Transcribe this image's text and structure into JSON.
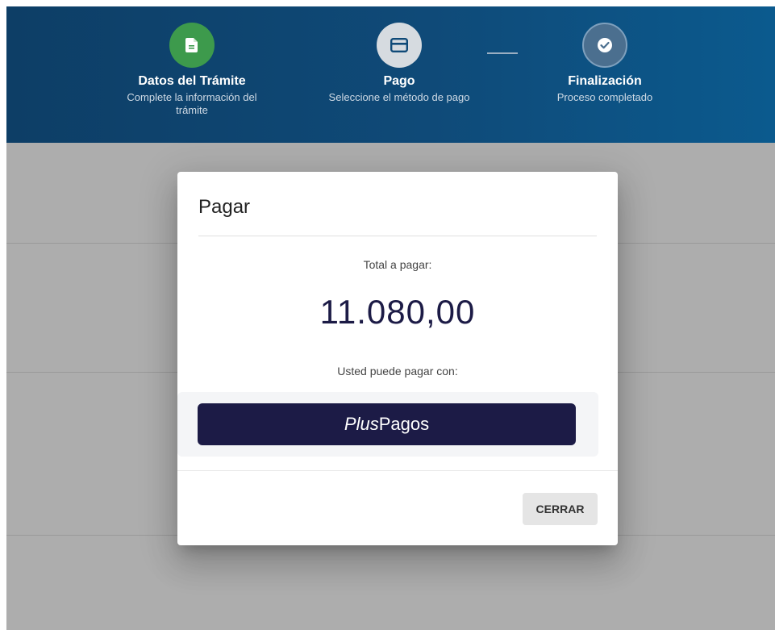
{
  "stepper": {
    "steps": [
      {
        "title": "Datos del Trámite",
        "subtitle": "Complete la información del trámite",
        "icon": "document-icon",
        "status": "completed"
      },
      {
        "title": "Pago",
        "subtitle": "Seleccione el método de pago",
        "icon": "card-icon",
        "status": "active"
      },
      {
        "title": "Finalización",
        "subtitle": "Proceso completado",
        "icon": "check-circle-icon",
        "status": "pending"
      }
    ]
  },
  "modal": {
    "title": "Pagar",
    "total_label": "Total a pagar:",
    "total_amount": "11.080,00",
    "pay_with_label": "Usted puede pagar con:",
    "payment_method": {
      "prefix": "Plus",
      "suffix": "Pagos"
    },
    "close_label": "CERRAR"
  },
  "colors": {
    "header_bg": "#0f4a78",
    "completed": "#3d9a4c",
    "brand_navy": "#1c1b46"
  }
}
